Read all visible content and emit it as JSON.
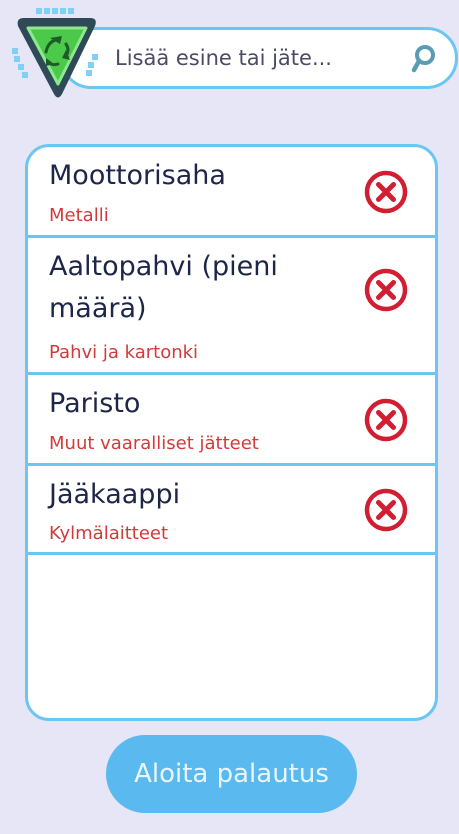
{
  "search": {
    "placeholder": "Lisää esine tai jäte...",
    "button_icon": "search-icon"
  },
  "logo_icon": "recycle-shield-icon",
  "items": [
    {
      "name": "Moottorisaha",
      "category": "Metalli",
      "remove_icon": "remove-x-circle-icon"
    },
    {
      "name": "Aaltopahvi (pieni määrä)",
      "category": "Pahvi ja kartonki",
      "remove_icon": "remove-x-circle-icon"
    },
    {
      "name": "Paristo",
      "category": "Muut vaaralliset jätteet",
      "remove_icon": "remove-x-circle-icon"
    },
    {
      "name": "Jääkaappi",
      "category": "Kylmälaitteet",
      "remove_icon": "remove-x-circle-icon"
    }
  ],
  "start_button": {
    "label": "Aloita palautus"
  },
  "colors": {
    "background": "#e6e6f6",
    "accent": "#6cc6f2",
    "button": "#5ab9ef",
    "category_text": "#d23a3a",
    "remove_icon": "#d21e32",
    "logo_green": "#4bc94b"
  }
}
